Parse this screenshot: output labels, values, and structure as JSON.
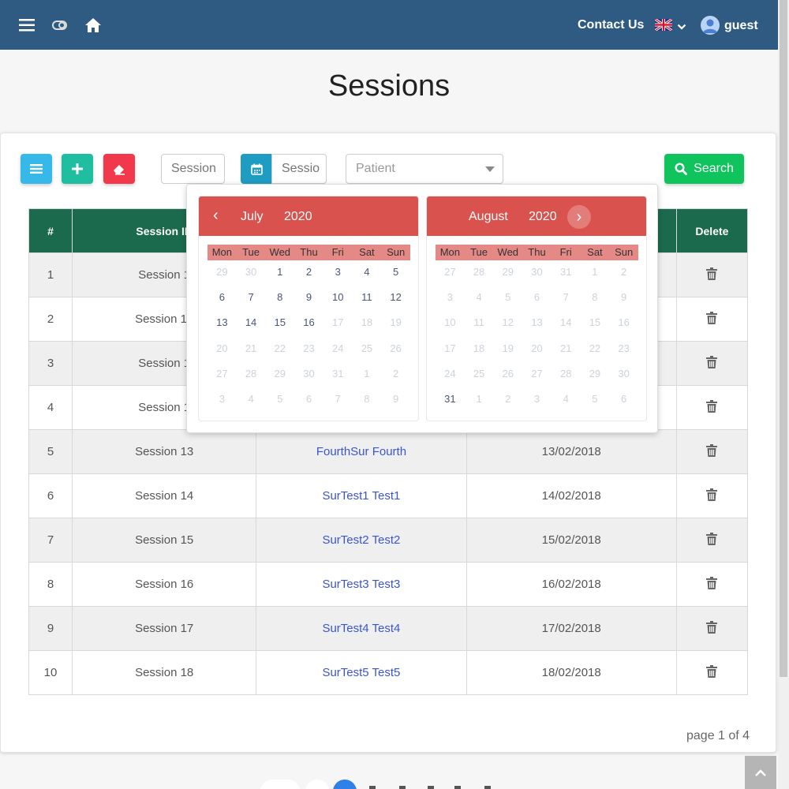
{
  "nav": {
    "contact_label": "Contact Us",
    "user_label": "guest"
  },
  "page": {
    "title": "Sessions"
  },
  "toolbar": {
    "session_placeholder": "Session",
    "date_placeholder": "Sessio",
    "patient_placeholder": "Patient",
    "search_label": "Search",
    "colors": {
      "list": "#36b9e8",
      "add": "#1fbea0",
      "clear": "#f2394b",
      "search": "#0fc45c"
    }
  },
  "table": {
    "headers": [
      "#",
      "Session ID",
      "",
      "",
      "Delete"
    ],
    "rows": [
      {
        "num": "1",
        "session": "Session 1",
        "surgeon": "",
        "date": ""
      },
      {
        "num": "2",
        "session": "Session 10",
        "surgeon": "",
        "date": ""
      },
      {
        "num": "3",
        "session": "Session 1",
        "surgeon": "",
        "date": ""
      },
      {
        "num": "4",
        "session": "Session 1",
        "surgeon": "",
        "date": ""
      },
      {
        "num": "5",
        "session": "Session 13",
        "surgeon": "FourthSur Fourth",
        "date": "13/02/2018"
      },
      {
        "num": "6",
        "session": "Session 14",
        "surgeon": "SurTest1 Test1",
        "date": "14/02/2018"
      },
      {
        "num": "7",
        "session": "Session 15",
        "surgeon": "SurTest2 Test2",
        "date": "15/02/2018"
      },
      {
        "num": "8",
        "session": "Session 16",
        "surgeon": "SurTest3 Test3",
        "date": "16/02/2018"
      },
      {
        "num": "9",
        "session": "Session 17",
        "surgeon": "SurTest4 Test4",
        "date": "17/02/2018"
      },
      {
        "num": "10",
        "session": "Session 18",
        "surgeon": "SurTest5 Test5",
        "date": "18/02/2018"
      }
    ]
  },
  "pagination": {
    "info": "page 1 of 4"
  },
  "datepicker": {
    "weekdays": [
      "Mon",
      "Tue",
      "Wed",
      "Thu",
      "Fri",
      "Sat",
      "Sun"
    ],
    "months": [
      {
        "name": "July",
        "year": "2020",
        "days": [
          {
            "d": "29",
            "m": true
          },
          {
            "d": "30",
            "m": true
          },
          {
            "d": "1",
            "m": false
          },
          {
            "d": "2",
            "m": false
          },
          {
            "d": "3",
            "m": false
          },
          {
            "d": "4",
            "m": false
          },
          {
            "d": "5",
            "m": false
          },
          {
            "d": "6",
            "m": false
          },
          {
            "d": "7",
            "m": false
          },
          {
            "d": "8",
            "m": false
          },
          {
            "d": "9",
            "m": false
          },
          {
            "d": "10",
            "m": false
          },
          {
            "d": "11",
            "m": false
          },
          {
            "d": "12",
            "m": false
          },
          {
            "d": "13",
            "m": false
          },
          {
            "d": "14",
            "m": false
          },
          {
            "d": "15",
            "m": false
          },
          {
            "d": "16",
            "m": false
          },
          {
            "d": "17",
            "m": true
          },
          {
            "d": "18",
            "m": true
          },
          {
            "d": "19",
            "m": true
          },
          {
            "d": "20",
            "m": true
          },
          {
            "d": "21",
            "m": true
          },
          {
            "d": "22",
            "m": true
          },
          {
            "d": "23",
            "m": true
          },
          {
            "d": "24",
            "m": true
          },
          {
            "d": "25",
            "m": true
          },
          {
            "d": "26",
            "m": true
          },
          {
            "d": "27",
            "m": true
          },
          {
            "d": "28",
            "m": true
          },
          {
            "d": "29",
            "m": true
          },
          {
            "d": "30",
            "m": true
          },
          {
            "d": "31",
            "m": true
          },
          {
            "d": "1",
            "m": true
          },
          {
            "d": "2",
            "m": true
          },
          {
            "d": "3",
            "m": true
          },
          {
            "d": "4",
            "m": true
          },
          {
            "d": "5",
            "m": true
          },
          {
            "d": "6",
            "m": true
          },
          {
            "d": "7",
            "m": true
          },
          {
            "d": "8",
            "m": true
          },
          {
            "d": "9",
            "m": true
          }
        ]
      },
      {
        "name": "August",
        "year": "2020",
        "days": [
          {
            "d": "27",
            "m": true
          },
          {
            "d": "28",
            "m": true
          },
          {
            "d": "29",
            "m": true
          },
          {
            "d": "30",
            "m": true
          },
          {
            "d": "31",
            "m": true
          },
          {
            "d": "1",
            "m": true
          },
          {
            "d": "2",
            "m": true
          },
          {
            "d": "3",
            "m": true
          },
          {
            "d": "4",
            "m": true
          },
          {
            "d": "5",
            "m": true
          },
          {
            "d": "6",
            "m": true
          },
          {
            "d": "7",
            "m": true
          },
          {
            "d": "8",
            "m": true
          },
          {
            "d": "9",
            "m": true
          },
          {
            "d": "10",
            "m": true
          },
          {
            "d": "11",
            "m": true
          },
          {
            "d": "12",
            "m": true
          },
          {
            "d": "13",
            "m": true
          },
          {
            "d": "14",
            "m": true
          },
          {
            "d": "15",
            "m": true
          },
          {
            "d": "16",
            "m": true
          },
          {
            "d": "17",
            "m": true
          },
          {
            "d": "18",
            "m": true
          },
          {
            "d": "19",
            "m": true
          },
          {
            "d": "20",
            "m": true
          },
          {
            "d": "21",
            "m": true
          },
          {
            "d": "22",
            "m": true
          },
          {
            "d": "23",
            "m": true
          },
          {
            "d": "24",
            "m": true
          },
          {
            "d": "25",
            "m": true
          },
          {
            "d": "26",
            "m": true
          },
          {
            "d": "27",
            "m": true
          },
          {
            "d": "28",
            "m": true
          },
          {
            "d": "29",
            "m": true
          },
          {
            "d": "30",
            "m": true
          },
          {
            "d": "31",
            "m": false
          },
          {
            "d": "1",
            "m": true
          },
          {
            "d": "2",
            "m": true
          },
          {
            "d": "3",
            "m": true
          },
          {
            "d": "4",
            "m": true
          },
          {
            "d": "5",
            "m": true
          },
          {
            "d": "6",
            "m": true
          }
        ]
      }
    ]
  }
}
